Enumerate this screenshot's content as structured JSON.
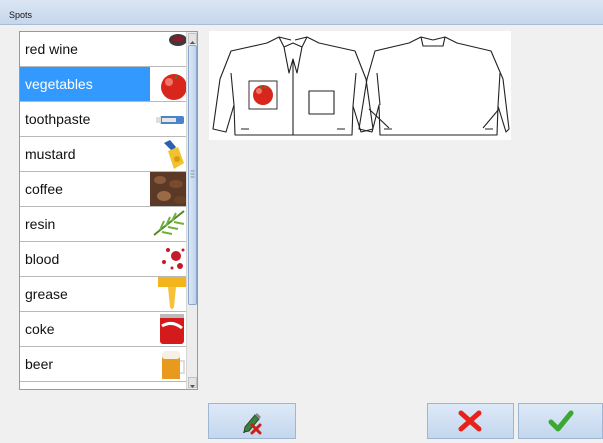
{
  "window": {
    "title": "Spots"
  },
  "list": {
    "items": [
      {
        "label": "red wine",
        "thumb": "wine-glass"
      },
      {
        "label": "vegetables",
        "thumb": "tomato",
        "selected": true
      },
      {
        "label": "toothpaste",
        "thumb": "toothpaste-tube"
      },
      {
        "label": "mustard",
        "thumb": "mustard-bottle"
      },
      {
        "label": "coffee",
        "thumb": "coffee-beans"
      },
      {
        "label": "resin",
        "thumb": "pine-branch"
      },
      {
        "label": "blood",
        "thumb": "blood-splatter"
      },
      {
        "label": "grease",
        "thumb": "grease-drip"
      },
      {
        "label": "coke",
        "thumb": "cola-can"
      },
      {
        "label": "beer",
        "thumb": "beer-mug"
      }
    ]
  },
  "preview": {
    "garment": "jacket-front-and-back",
    "spot_marker": "tomato"
  },
  "toolbar": {
    "buttons": [
      {
        "name": "edit-eraser-button",
        "icon": "pencil-eraser-icon"
      },
      {
        "name": "cancel-button",
        "icon": "red-x-icon"
      },
      {
        "name": "confirm-button",
        "icon": "green-check-icon"
      }
    ]
  },
  "colors": {
    "selection": "#3399ff",
    "titlebar": "#c6d6ec",
    "cancel": "#e8211b",
    "confirm": "#3aa832"
  }
}
